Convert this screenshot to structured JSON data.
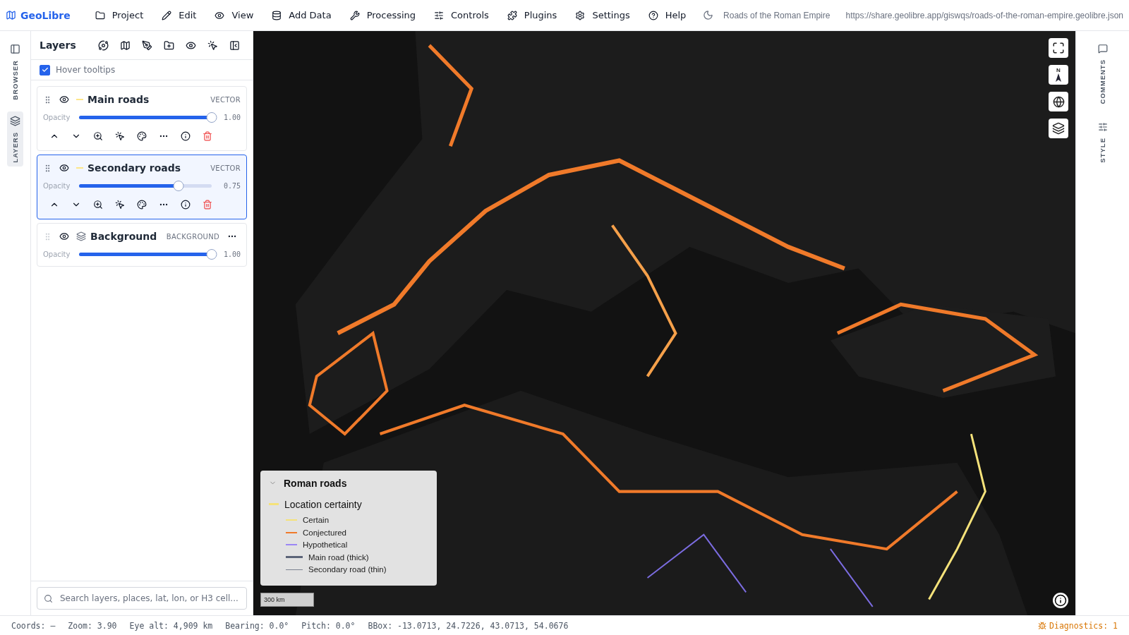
{
  "app": {
    "name": "GeoLibre"
  },
  "menu": [
    {
      "label": "Project"
    },
    {
      "label": "Edit"
    },
    {
      "label": "View"
    },
    {
      "label": "Add Data"
    },
    {
      "label": "Processing"
    },
    {
      "label": "Controls"
    },
    {
      "label": "Plugins"
    },
    {
      "label": "Settings"
    },
    {
      "label": "Help"
    }
  ],
  "document_title": "Roads of the Roman Empire",
  "url": "https://share.geolibre.app/giswqs/roads-of-the-roman-empire.geolibre.json",
  "left_rail": [
    {
      "label": "BROWSER",
      "selected": false
    },
    {
      "label": "LAYERS",
      "selected": true
    }
  ],
  "layers_panel": {
    "title": "Layers",
    "hover_tooltips": {
      "label": "Hover tooltips",
      "checked": true
    },
    "layers": [
      {
        "name": "Main roads",
        "type": "VECTOR",
        "kind": "vector",
        "selected": false,
        "visible": true,
        "opacity_label": "Opacity",
        "level": 1,
        "reading": "1.00"
      },
      {
        "name": "Secondary roads",
        "type": "VECTOR",
        "kind": "vector",
        "selected": true,
        "visible": true,
        "opacity_label": "Opacity",
        "level": 0.75,
        "reading": "0.75"
      },
      {
        "name": "Background",
        "type": "BACKGROUND",
        "kind": "background",
        "selected": false,
        "visible": true,
        "opacity_label": "Opacity",
        "level": 1,
        "reading": "1.00"
      }
    ],
    "search": {
      "placeholder": "Search layers, places, lat, lon, or H3 cell..."
    }
  },
  "map": {
    "kind": "picture",
    "compass": "N",
    "scale": "300 km",
    "legend": {
      "title": "Roman roads",
      "expanded": true,
      "group": {
        "label": "Location certainty",
        "color": "#f5e27a"
      },
      "items": [
        {
          "label": "Certain",
          "color": "#f5e27a",
          "kind": "thin"
        },
        {
          "label": "Conjectured",
          "color": "#f07a2a",
          "kind": "thin"
        },
        {
          "label": "Hypothetical",
          "color": "#9b87f5",
          "kind": "thin"
        },
        {
          "label": "Main road (thick)",
          "color": "#5b6478",
          "kind": "thick"
        },
        {
          "label": "Secondary road (thin)",
          "color": "#7b8190",
          "kind": "line"
        }
      ]
    }
  },
  "right_rail": [
    {
      "label": "COMMENTS"
    },
    {
      "label": "STYLE"
    }
  ],
  "status_bar": {
    "items": [
      "Coords: —",
      "Zoom: 3.90",
      "Eye alt: 4,909 km",
      "Bearing: 0.0°",
      "Pitch: 0.0°",
      "BBox: -13.0713, 24.7226, 43.0713, 54.0676"
    ],
    "diagnostics": "Diagnostics: 1"
  }
}
